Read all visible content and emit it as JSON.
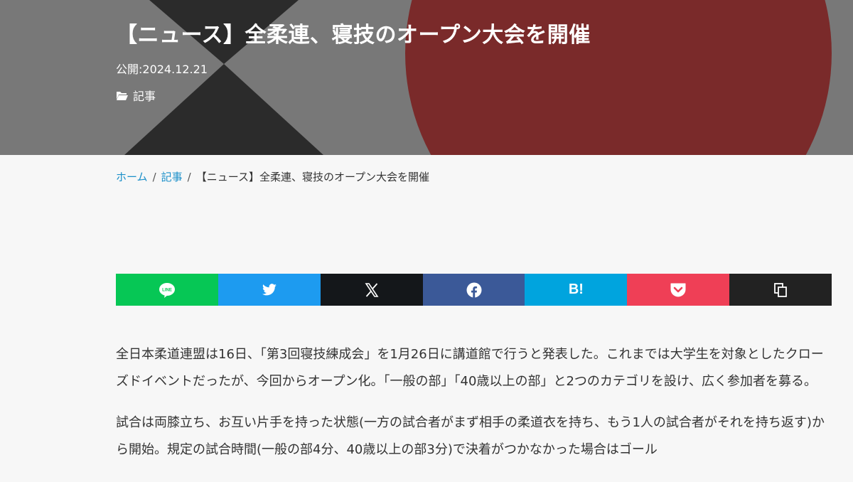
{
  "hero": {
    "title": "【ニュース】全柔連、寝技のオープン大会を開催",
    "published": "公開:2024.12.21",
    "category": "記事",
    "category_icon": "folder-open-icon"
  },
  "breadcrumb": {
    "home": "ホーム",
    "category": "記事",
    "current": "【ニュース】全柔連、寝技のオープン大会を開催",
    "separator": "/"
  },
  "share": {
    "buttons": [
      {
        "name": "line",
        "icon": "line-icon",
        "color": "#06c755",
        "label": "LINE"
      },
      {
        "name": "twitter",
        "icon": "twitter-bird-icon",
        "color": "#1d9bf0"
      },
      {
        "name": "x",
        "icon": "x-logo-icon",
        "color": "#14171a"
      },
      {
        "name": "facebook",
        "icon": "facebook-icon",
        "color": "#3b5998"
      },
      {
        "name": "hatena",
        "icon": "hatena-bookmark-icon",
        "color": "#00a4de",
        "label": "B!"
      },
      {
        "name": "pocket",
        "icon": "pocket-icon",
        "color": "#ef3f56"
      },
      {
        "name": "copy",
        "icon": "copy-icon",
        "color": "#222222"
      }
    ]
  },
  "article": {
    "paragraphs": [
      "全日本柔道連盟は16日、「第3回寝技練成会」を1月26日に講道館で行うと発表した。これまでは大学生を対象としたクローズドイベントだったが、今回からオープン化。「一般の部」「40歳以上の部」と2つのカテゴリを設け、広く参加者を募る。",
      "試合は両膝立ち、お互い片手を持った状態(一方の試合者がまず相手の柔道衣を持ち、もう1人の試合者がそれを持ち返す)から開始。規定の試合時間(一般の部4分、40歳以上の部3分)で決着がつかなかった場合はゴール"
    ]
  },
  "colors": {
    "hero_bg": "#787878",
    "hero_dark_shape": "#2b2b2b",
    "hero_red_circle": "#7a2a2a",
    "link": "#1a8fc9",
    "page_bg": "#f7f7f7"
  }
}
